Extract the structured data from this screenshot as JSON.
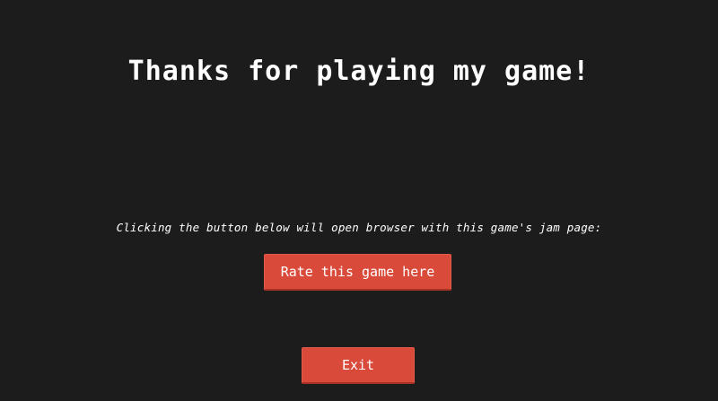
{
  "end_screen": {
    "title": "Thanks for playing my game!",
    "message": "Clicking the button below will open browser with this game's jam page:",
    "rate_button_label": "Rate this game here",
    "exit_button_label": "Exit"
  },
  "colors": {
    "background": "#1c1c1c",
    "button": "#d94a3a",
    "text": "#ffffff"
  }
}
